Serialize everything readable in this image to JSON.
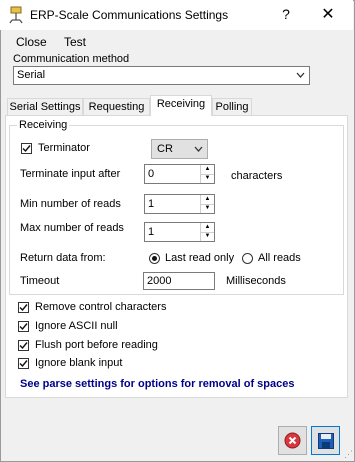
{
  "window": {
    "title": "ERP-Scale Communications Settings",
    "help_label": "?",
    "close_label": "✕"
  },
  "menu": {
    "close": "Close",
    "test": "Test"
  },
  "comm": {
    "label": "Communication method",
    "value": "Serial"
  },
  "tabs": [
    {
      "label": "Serial Settings",
      "active": false
    },
    {
      "label": "Requesting",
      "active": false
    },
    {
      "label": "Receiving",
      "active": true
    },
    {
      "label": "Polling",
      "active": false
    }
  ],
  "receiving": {
    "group_title": "Receiving",
    "terminator_label": "Terminator",
    "terminator_checked": true,
    "terminator_value": "CR",
    "terminate_after_label": "Terminate input after",
    "terminate_after_value": "0",
    "characters_label": "characters",
    "min_reads_label": "Min number of reads",
    "min_reads_value": "1",
    "max_reads_label": "Max number of reads",
    "max_reads_value": "1",
    "return_from_label": "Return data from:",
    "last_read_label": "Last read only",
    "last_read_selected": true,
    "all_reads_label": "All reads",
    "all_reads_selected": false,
    "timeout_label": "Timeout",
    "timeout_value": "2000",
    "ms_label": "Milliseconds"
  },
  "options": [
    {
      "label": "Remove control characters",
      "checked": true
    },
    {
      "label": "Ignore ASCII null",
      "checked": true
    },
    {
      "label": "Flush port before reading",
      "checked": true
    },
    {
      "label": "Ignore blank input",
      "checked": true
    }
  ],
  "parse_note": "See parse settings for options for removal of spaces",
  "icons": {
    "app": "app-icon",
    "cancel": "cancel-icon",
    "save": "save-icon",
    "dropdown": "chevron-down-icon"
  },
  "colors": {
    "note": "#00008b",
    "cancel_red": "#d9363e",
    "save_blue": "#1f5fb5"
  }
}
